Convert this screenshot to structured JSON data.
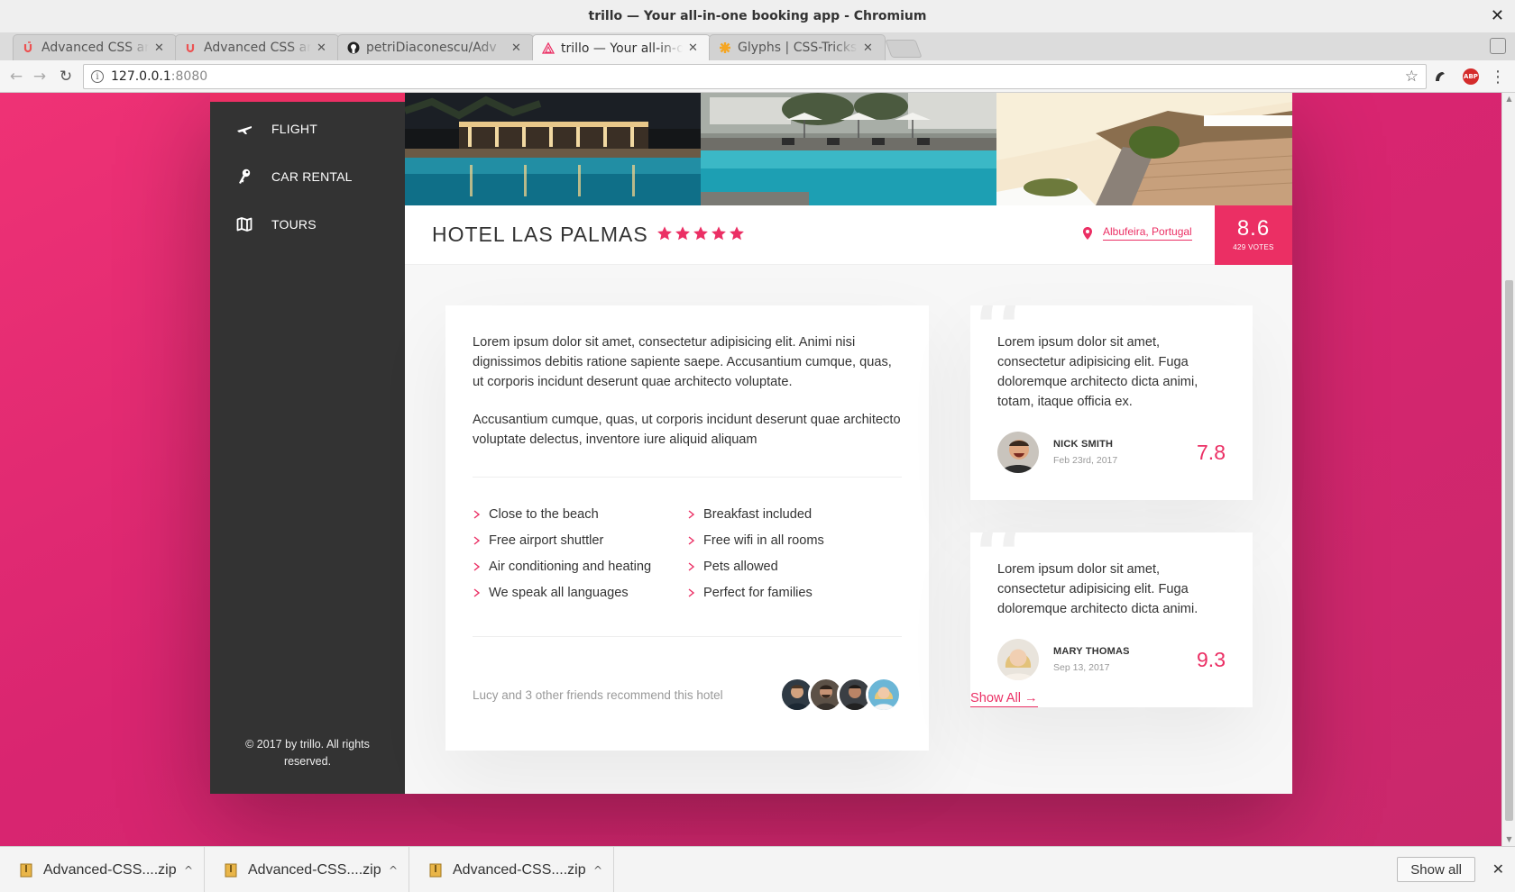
{
  "window": {
    "title": "trillo — Your all-in-one booking app - Chromium"
  },
  "tabs": [
    {
      "label": "Advanced CSS and S",
      "favicon": "udemy-icon"
    },
    {
      "label": "Advanced CSS and S",
      "favicon": "udemy-icon"
    },
    {
      "label": "petriDiaconescu/Adv",
      "favicon": "github-icon"
    },
    {
      "label": "trillo — Your all-in-o",
      "favicon": "trillo-icon",
      "active": true
    },
    {
      "label": "Glyphs | CSS-Tricks",
      "favicon": "css-tricks-icon"
    }
  ],
  "address_bar": {
    "host": "127.0.0.1",
    "port": ":8080"
  },
  "extensions": {
    "abp_label": "ABP"
  },
  "colors": {
    "primary": "#eb2f64",
    "sidebar": "#333333"
  },
  "sidebar": {
    "items": [
      {
        "label": "FLIGHT",
        "icon": "aircraft-icon"
      },
      {
        "label": "CAR RENTAL",
        "icon": "key-icon"
      },
      {
        "label": "TOURS",
        "icon": "map-icon"
      }
    ],
    "legal": "© 2017 by trillo. All rights reserved."
  },
  "hotel": {
    "name": "HOTEL LAS PALMAS",
    "stars": 5,
    "location": "Albufeira, Portugal",
    "rating": "8.6",
    "votes": "429 VOTES"
  },
  "description": {
    "paragraphs": [
      "Lorem ipsum dolor sit amet, consectetur adipisicing elit. Animi nisi dignissimos debitis ratione sapiente saepe. Accusantium cumque, quas, ut corporis incidunt deserunt quae architecto voluptate.",
      "Accusantium cumque, quas, ut corporis incidunt deserunt quae architecto voluptate delectus, inventore iure aliquid aliquam"
    ],
    "features": [
      "Close to the beach",
      "Breakfast included",
      "Free airport shuttler",
      "Free wifi in all rooms",
      "Air conditioning and heating",
      "Pets allowed",
      "We speak all languages",
      "Perfect for families"
    ],
    "recommend": "Lucy and 3 other friends recommend this hotel"
  },
  "reviews": [
    {
      "text": "Lorem ipsum dolor sit amet, consectetur adipisicing elit. Fuga doloremque architecto dicta animi, totam, itaque officia ex.",
      "name": "NICK SMITH",
      "date": "Feb 23rd, 2017",
      "rating": "7.8"
    },
    {
      "text": "Lorem ipsum dolor sit amet, consectetur adipisicing elit. Fuga doloremque architecto dicta animi.",
      "name": "MARY THOMAS",
      "date": "Sep 13, 2017",
      "rating": "9.3"
    }
  ],
  "show_all_link": "Show All →",
  "downloads": {
    "items": [
      {
        "name": "Advanced-CSS....zip"
      },
      {
        "name": "Advanced-CSS....zip"
      },
      {
        "name": "Advanced-CSS....zip"
      }
    ],
    "show_all": "Show all"
  }
}
